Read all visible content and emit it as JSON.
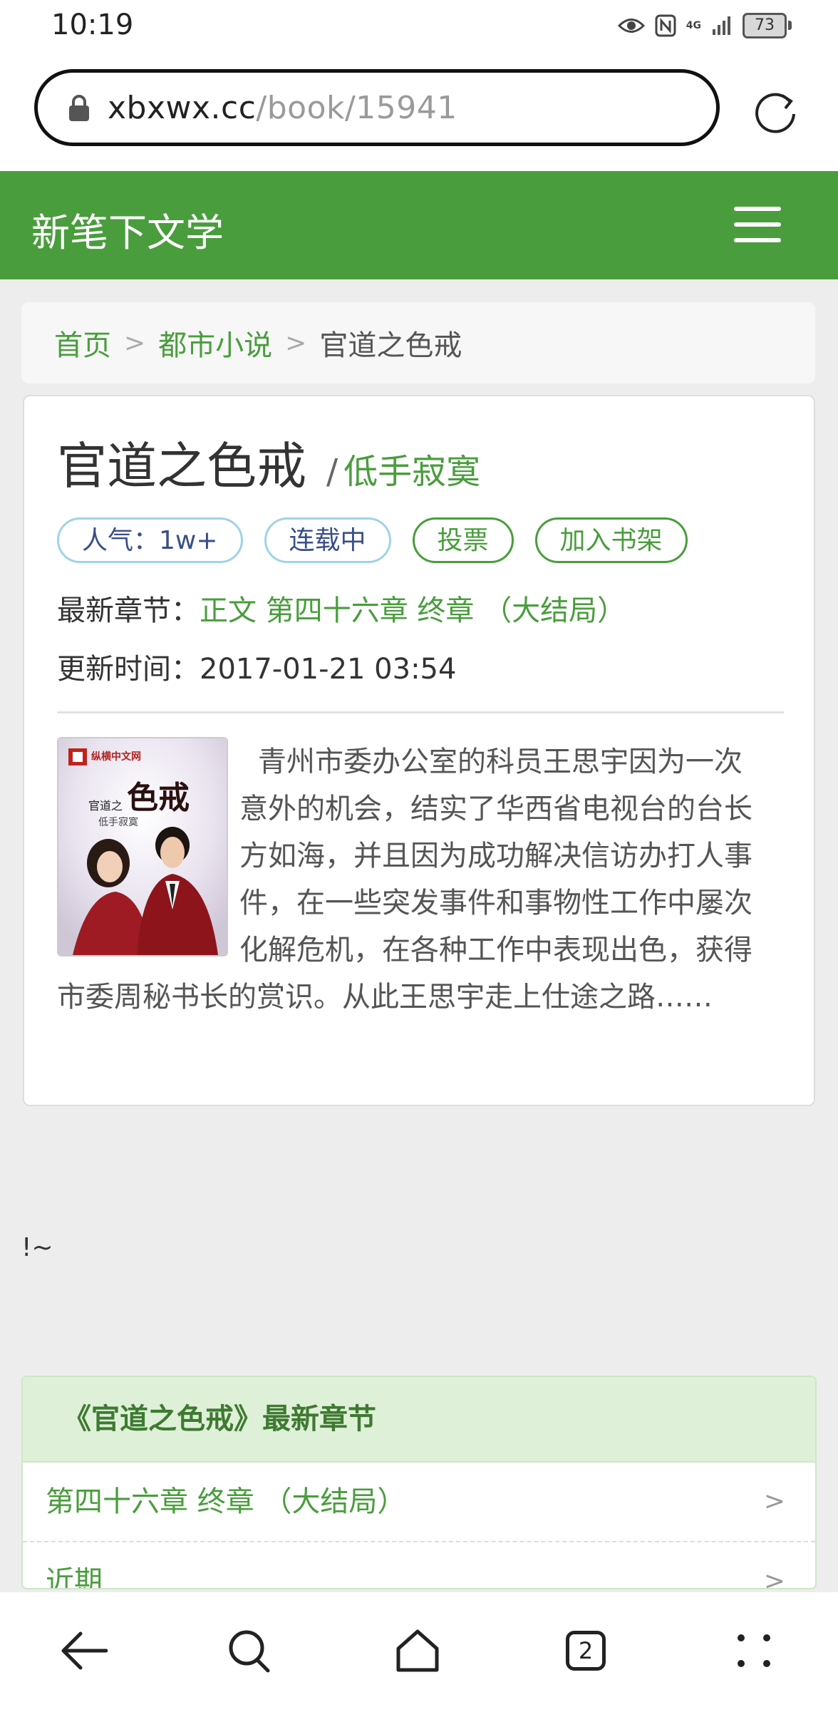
{
  "status_bar": {
    "time": "10:19",
    "network": "4G",
    "battery": "73"
  },
  "browser": {
    "url_domain": "xbxwx.cc",
    "url_path": "/book/15941",
    "tab_count": "2"
  },
  "site": {
    "title": "新笔下文学"
  },
  "breadcrumb": {
    "home": "首页",
    "separator": ">",
    "category": "都市小说",
    "current": "官道之色戒"
  },
  "book": {
    "title": "官道之色戒",
    "author_slash": "/",
    "author": "低手寂寞",
    "tags": {
      "popularity": "人气：1w+",
      "status": "连载中",
      "vote": "投票",
      "add_shelf": "加入书架"
    },
    "latest_label": "最新章节：",
    "latest_chapter": "正文 第四十六章 终章 （大结局）",
    "update_label": "更新时间：",
    "update_time": "2017-01-21 03:54",
    "description": "青州市委办公室的科员王思宇因为一次意外的机会，结实了华西省电视台的台长方如海，并且因为成功解决信访办打人事件，在一些突发事件和事物性工作中屡次化解危机，在各种工作中表现出色，获得市委周秘书长的赏识。从此王思宇走上仕途之路……",
    "cover": {
      "publisher": "纵横中文网",
      "title_small": "官道之",
      "title_big": "色戒",
      "author": "低手寂寞"
    }
  },
  "ad_placeholder": "!~",
  "latest_section": {
    "header": "《官道之色戒》最新章节",
    "items": [
      {
        "title": "第四十六章 终章 （大结局）",
        "arrow": ">"
      },
      {
        "title": "近期",
        "arrow": ">"
      }
    ]
  },
  "colors": {
    "brand_green": "#4a9d3d",
    "tag_blue_border": "#9fd3e8",
    "header_bg": "#dff0d8"
  }
}
